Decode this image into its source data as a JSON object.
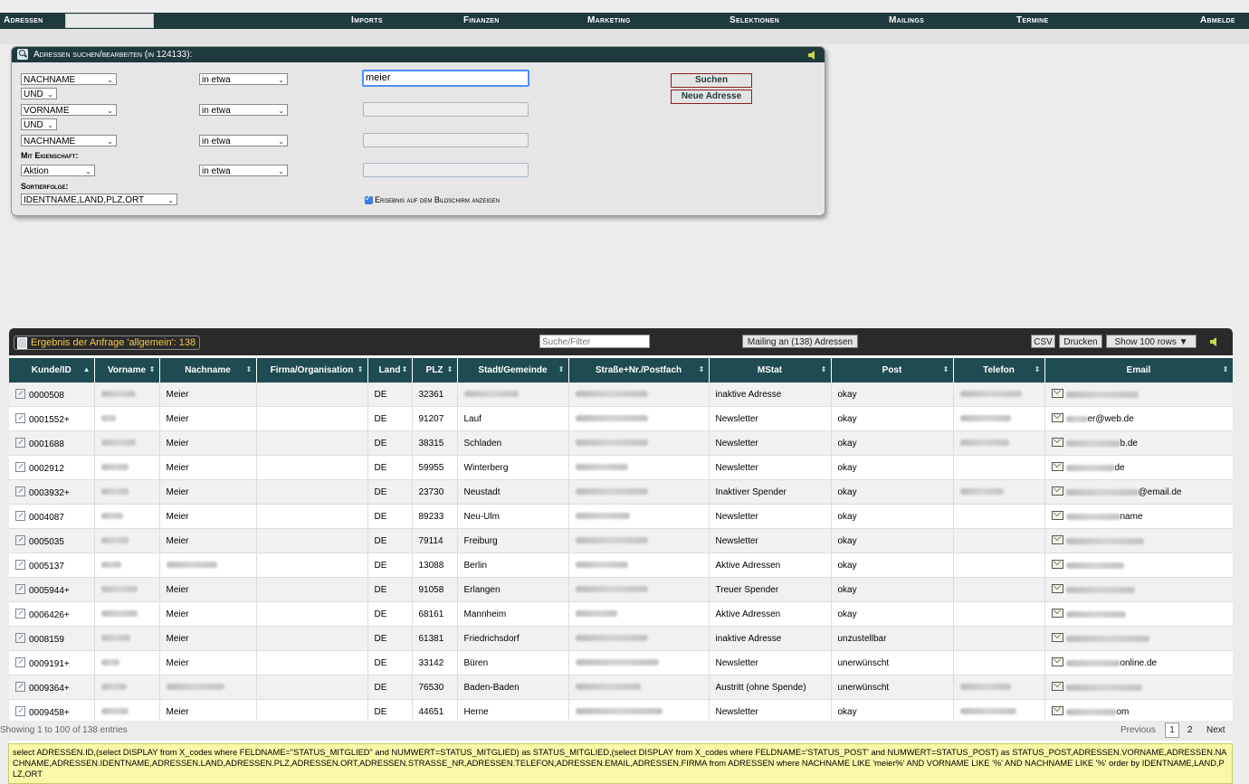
{
  "nav": {
    "adressen": "Adressen",
    "imports": "Imports",
    "finanzen": "Finanzen",
    "marketing": "Marketing",
    "selektionen": "Selektionen",
    "mailings": "Mailings",
    "termine": "Termine",
    "abmelden": "Abmelde"
  },
  "search": {
    "title": "Adressen suchen/bearbeiten (in 124133):",
    "field1": "NACHNAME",
    "op1": "in etwa",
    "value1": "meier",
    "conj1": "UND",
    "field2": "VORNAME",
    "op2": "in etwa",
    "value2": "",
    "conj2": "UND",
    "field3": "NACHNAME",
    "op3": "in etwa",
    "value3": "",
    "property_label": "Mit Eigenschaft:",
    "property_field": "Aktion",
    "property_op": "in etwa",
    "property_value": "",
    "sort_label": "Sortierfolge:",
    "sort_value": "IDENTNAME,LAND,PLZ,ORT",
    "search_button": "Suchen",
    "new_button": "Neue Adresse",
    "show_result_label": "Ergebnis auf dem Bildschirm anzeigen"
  },
  "results": {
    "title": "Ergebnis der Anfrage 'allgemein': 138",
    "filter_placeholder": "Suche/Filter",
    "mailing_button": "Mailing an (138) Adressen",
    "csv_button": "CSV",
    "print_button": "Drucken",
    "rows_button": "Show 100 rows",
    "columns": [
      "Kunde/ID",
      "Vorname",
      "Nachname",
      "Firma/Organisation",
      "Land",
      "PLZ",
      "Stadt/Gemeinde",
      "Straße+Nr./Postfach",
      "MStat",
      "Post",
      "Telefon",
      "Email"
    ],
    "rows": [
      {
        "id": "0000508",
        "nachname": "Meier",
        "land": "DE",
        "plz": "32361",
        "stadt": "",
        "mstat": "inaktive Adresse",
        "post": "okay",
        "email": ""
      },
      {
        "id": "0001552+",
        "nachname": "Meier",
        "land": "DE",
        "plz": "91207",
        "stadt": "Lauf",
        "mstat": "Newsletter",
        "post": "okay",
        "email": "er@web.de"
      },
      {
        "id": "0001688",
        "nachname": "Meier",
        "land": "DE",
        "plz": "38315",
        "stadt": "Schladen",
        "mstat": "Newsletter",
        "post": "okay",
        "email": "b.de"
      },
      {
        "id": "0002912",
        "nachname": "Meier",
        "land": "DE",
        "plz": "59955",
        "stadt": "Winterberg",
        "mstat": "Newsletter",
        "post": "okay",
        "email": "de"
      },
      {
        "id": "0003932+",
        "nachname": "Meier",
        "land": "DE",
        "plz": "23730",
        "stadt": "Neustadt",
        "mstat": "Inaktiver Spender",
        "post": "okay",
        "email": "@email.de"
      },
      {
        "id": "0004087",
        "nachname": "Meier",
        "land": "DE",
        "plz": "89233",
        "stadt": "Neu-Ulm",
        "mstat": "Newsletter",
        "post": "okay",
        "email": "name"
      },
      {
        "id": "0005035",
        "nachname": "Meier",
        "land": "DE",
        "plz": "79114",
        "stadt": "Freiburg",
        "mstat": "Newsletter",
        "post": "okay",
        "email": ""
      },
      {
        "id": "0005137",
        "nachname": "",
        "land": "DE",
        "plz": "13088",
        "stadt": "Berlin",
        "mstat": "Aktive Adressen",
        "post": "okay",
        "email": ""
      },
      {
        "id": "0005944+",
        "nachname": "Meier",
        "land": "DE",
        "plz": "91058",
        "stadt": "Erlangen",
        "mstat": "Treuer Spender",
        "post": "okay",
        "email": ""
      },
      {
        "id": "0006426+",
        "nachname": "Meier",
        "land": "DE",
        "plz": "68161",
        "stadt": "Mannheim",
        "mstat": "Aktive Adressen",
        "post": "okay",
        "email": ""
      },
      {
        "id": "0008159",
        "nachname": "Meier",
        "land": "DE",
        "plz": "61381",
        "stadt": "Friedrichsdorf",
        "mstat": "inaktive Adresse",
        "post": "unzustellbar",
        "email": ""
      },
      {
        "id": "0009191+",
        "nachname": "Meier",
        "land": "DE",
        "plz": "33142",
        "stadt": "Büren",
        "mstat": "Newsletter",
        "post": "unerwünscht",
        "email": "online.de"
      },
      {
        "id": "0009364+",
        "nachname": "",
        "land": "DE",
        "plz": "76530",
        "stadt": "Baden-Baden",
        "mstat": "Austritt (ohne Spende)",
        "post": "unerwünscht",
        "email": ""
      },
      {
        "id": "0009458+",
        "nachname": "Meier",
        "land": "DE",
        "plz": "44651",
        "stadt": "Herne",
        "mstat": "Newsletter",
        "post": "okay",
        "email": "om"
      }
    ]
  },
  "footer": {
    "showing": "Showing 1 to 100 of 138 entries",
    "previous": "Previous",
    "page1": "1",
    "page2": "2",
    "next": "Next"
  },
  "sql": "select ADRESSEN.ID,(select DISPLAY from X_codes where FELDNAME=\"STATUS_MITGLIED\" and NUMWERT=STATUS_MITGLIED) as STATUS_MITGLIED,(select DISPLAY from X_codes where FELDNAME='STATUS_POST' and NUMWERT=STATUS_POST) as STATUS_POST,ADRESSEN.VORNAME,ADRESSEN.NACHNAME,ADRESSEN.IDENTNAME,ADRESSEN.LAND,ADRESSEN.PLZ,ADRESSEN.ORT,ADRESSEN.STRASSE_NR,ADRESSEN.TELEFON,ADRESSEN.EMAIL,ADRESSEN.FIRMA from ADRESSEN where NACHNAME LIKE 'meier%' AND VORNAME LIKE '%' AND NACHNAME LIKE '%' order by IDENTNAME,LAND,PLZ,ORT"
}
